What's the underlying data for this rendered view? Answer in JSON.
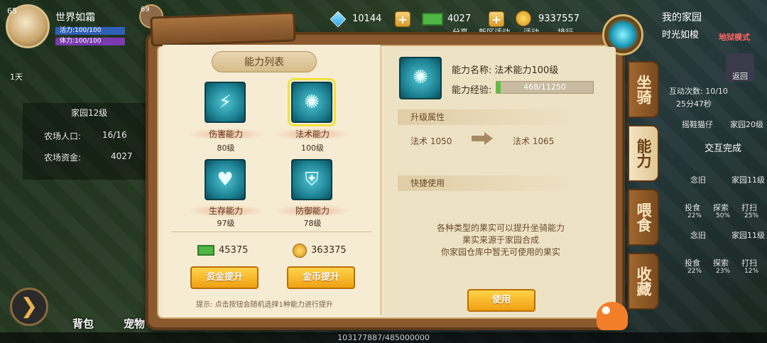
{
  "player": {
    "level": "65",
    "name": "世界如霜",
    "vitality": "活力:100/100",
    "stamina": "体力:100/100",
    "friend_level": "69",
    "days": "1天"
  },
  "currency": {
    "gems": "10144",
    "cash": "4027",
    "coins": "9337557",
    "plus": "+"
  },
  "top_links": [
    "分享",
    "新区活动",
    "活动",
    "排行"
  ],
  "home": {
    "title": "我的家园",
    "subtitle": "时光如梭",
    "mode": "地狱模式",
    "return": "返回"
  },
  "farm": {
    "title": "家园12级",
    "population_label": "农场人口:",
    "population": "16/16",
    "funds_label": "农场资金:",
    "funds": "4027"
  },
  "right_info": {
    "interact": "互动次数: 10/10",
    "timer": "25分47秒",
    "visitor1": "摇鞋猫仔",
    "visitor1_lv": "家园20级",
    "complete": "交互完成",
    "n1": "念旧",
    "n1_lv": "家园11级",
    "n2": "念旧",
    "n2_lv": "家园11级",
    "act1": "投食",
    "act2": "探索",
    "act3": "打扫",
    "p1": "22%",
    "p2": "50%",
    "p3": "25%",
    "p4": "22%",
    "p5": "23%",
    "p6": "12%"
  },
  "exp_total": "103177887/485000000",
  "bottom": {
    "bag": "背包",
    "pet": "宠物"
  },
  "panel": {
    "list_title": "能力列表",
    "abilities": [
      {
        "name": "伤害能力",
        "level": "80级",
        "icon": "lightning-icon"
      },
      {
        "name": "法术能力",
        "level": "100级",
        "icon": "paw-sun-icon"
      },
      {
        "name": "生存能力",
        "level": "97级",
        "icon": "heart-wings-icon"
      },
      {
        "name": "防御能力",
        "level": "78级",
        "icon": "shield-paw-icon"
      }
    ],
    "cash_amount": "45375",
    "coin_amount": "363375",
    "cash_btn": "资金提升",
    "coin_btn": "金币提升",
    "tip": "提示: 点击按钮会随机选择1种能力进行提升",
    "detail": {
      "name_label": "能力名称: 法术能力100级",
      "exp_label": "能力经验:",
      "exp_value": "468/11250",
      "exp_fraction": 0.042,
      "upgrade_title": "升级属性",
      "stat_from": "法术  1050",
      "stat_to": "法术  1065",
      "quick_title": "快捷使用",
      "msg1": "各种类型的果实可以提升坐骑能力",
      "msg2": "果实来源于家园合成",
      "msg3": "你家园仓库中暂无可使用的果实",
      "use_btn": "使用"
    },
    "tabs": [
      "坐骑",
      "能力",
      "喂食",
      "收藏"
    ]
  }
}
